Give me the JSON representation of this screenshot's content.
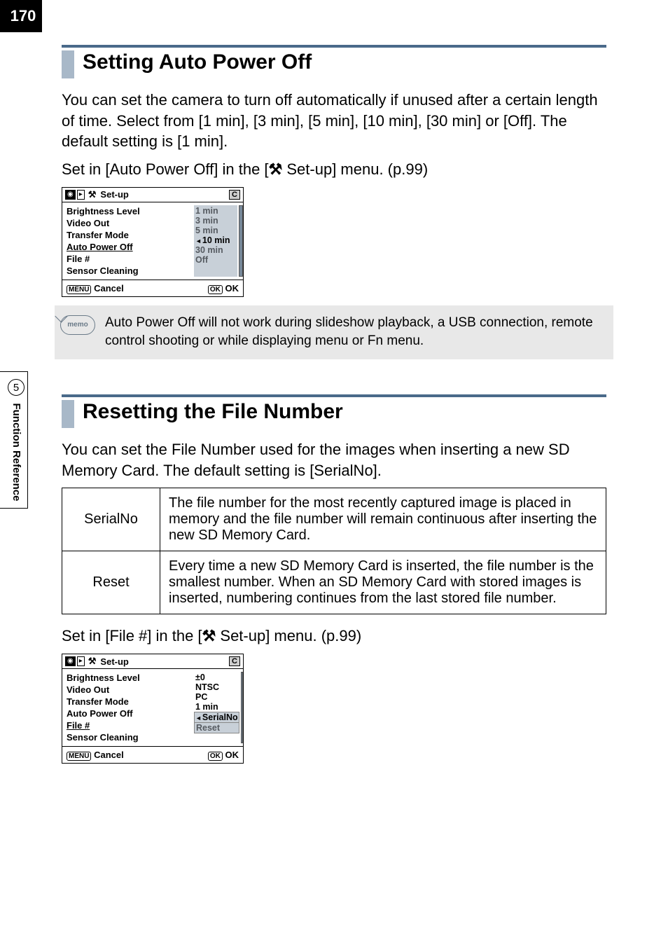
{
  "page_number": "170",
  "side_tab": {
    "number": "5",
    "label": "Function Reference"
  },
  "section1": {
    "title": "Setting Auto Power Off",
    "para": "You can set the camera to turn off automatically if unused after a certain length of time. Select from [1 min], [3 min], [5 min], [10 min], [30 min] or [Off]. The default setting is [1 min].",
    "para2_pre": "Set in [Auto Power Off] in the [",
    "para2_post": " Set-up] menu. (p.99)",
    "lcd": {
      "header_title": "Set-up",
      "items": [
        "Brightness Level",
        "Video Out",
        "Transfer Mode",
        "Auto Power Off",
        "File #",
        "Sensor Cleaning"
      ],
      "highlight_index": 3,
      "values": [
        "1 min",
        "3 min",
        "5 min",
        "10 min",
        "30 min",
        "Off"
      ],
      "selected_value_index": 3,
      "footer_left_btn": "MENU",
      "footer_left": "Cancel",
      "footer_right_btn": "OK",
      "footer_right": "OK"
    },
    "memo": "Auto Power Off will not work during slideshow playback, a USB connection, remote control shooting or while displaying menu or Fn menu."
  },
  "section2": {
    "title": "Resetting the File Number",
    "para": "You can set the File Number used for the images when inserting a new SD Memory Card. The default setting is [SerialNo].",
    "table": [
      {
        "k": "SerialNo",
        "v": "The file number for the most recently captured image is placed in memory and the file number will remain continuous after inserting the new SD Memory Card."
      },
      {
        "k": "Reset",
        "v": "Every time a new SD Memory Card is inserted, the file number is the smallest number. When an SD Memory Card with stored images is inserted, numbering continues from the last stored file number."
      }
    ],
    "para2_pre": "Set in [File #] in the [",
    "para2_post": " Set-up] menu. (p.99)",
    "lcd": {
      "header_title": "Set-up",
      "items": [
        "Brightness Level",
        "Video Out",
        "Transfer Mode",
        "Auto Power Off",
        "File #",
        "Sensor Cleaning"
      ],
      "highlight_index": 4,
      "values_col": [
        "±0",
        "NTSC",
        "PC",
        "1 min",
        "SerialNo",
        "Reset"
      ],
      "option_box_start": 4,
      "selected_value_index": 4,
      "footer_left_btn": "MENU",
      "footer_left": "Cancel",
      "footer_right_btn": "OK",
      "footer_right": "OK"
    }
  },
  "memo_label": "memo"
}
